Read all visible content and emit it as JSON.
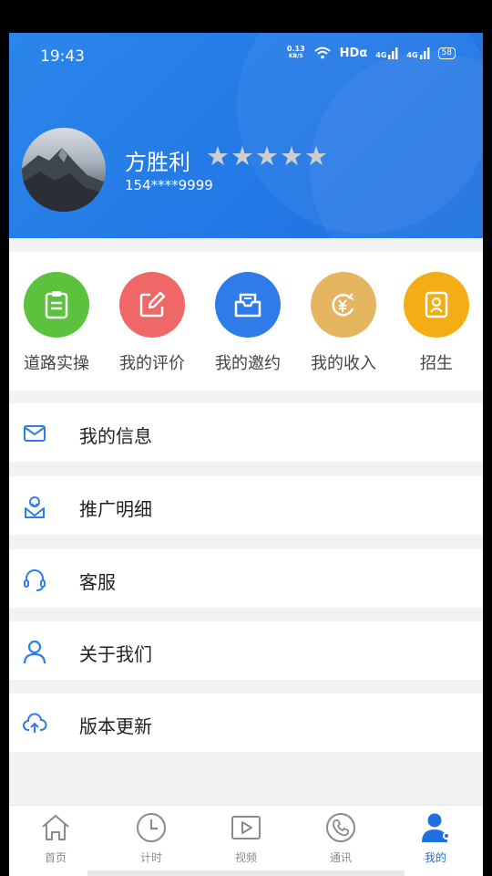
{
  "status_bar": {
    "time": "19:43",
    "speed_value": "0.13",
    "speed_unit": "KB/S",
    "hd": "HDα",
    "net1": "4G",
    "net2": "4G",
    "battery": "58"
  },
  "profile": {
    "name": "方胜利",
    "phone": "154****9999",
    "rating": 5
  },
  "quick_actions": [
    {
      "label": "道路实操",
      "icon": "clipboard-icon",
      "color": "#5cc13c"
    },
    {
      "label": "我的评价",
      "icon": "edit-icon",
      "color": "#ef6767"
    },
    {
      "label": "我的邀约",
      "icon": "inbox-icon",
      "color": "#2e7ce9"
    },
    {
      "label": "我的收入",
      "icon": "income-icon",
      "color": "#e5b560"
    },
    {
      "label": "招生",
      "icon": "contact-card-icon",
      "color": "#f4ad14"
    }
  ],
  "menu": [
    {
      "label": "我的信息",
      "icon": "mail-icon"
    },
    {
      "label": "推广明细",
      "icon": "promotion-icon"
    },
    {
      "label": "客服",
      "icon": "headset-icon"
    },
    {
      "label": "关于我们",
      "icon": "user-icon"
    },
    {
      "label": "版本更新",
      "icon": "cloud-upload-icon"
    }
  ],
  "tabs": [
    {
      "label": "首页",
      "icon": "home-icon",
      "active": false
    },
    {
      "label": "计时",
      "icon": "clock-icon",
      "active": false
    },
    {
      "label": "视频",
      "icon": "video-icon",
      "active": false
    },
    {
      "label": "通讯",
      "icon": "phone-icon",
      "active": false
    },
    {
      "label": "我的",
      "icon": "profile-icon",
      "active": true
    }
  ],
  "colors": {
    "primary": "#2379e6",
    "background": "#f2f2f2",
    "active_tab": "#1e6fe0",
    "menu_icon": "#2f7de8",
    "inactive_tab": "#8a8a8a"
  }
}
